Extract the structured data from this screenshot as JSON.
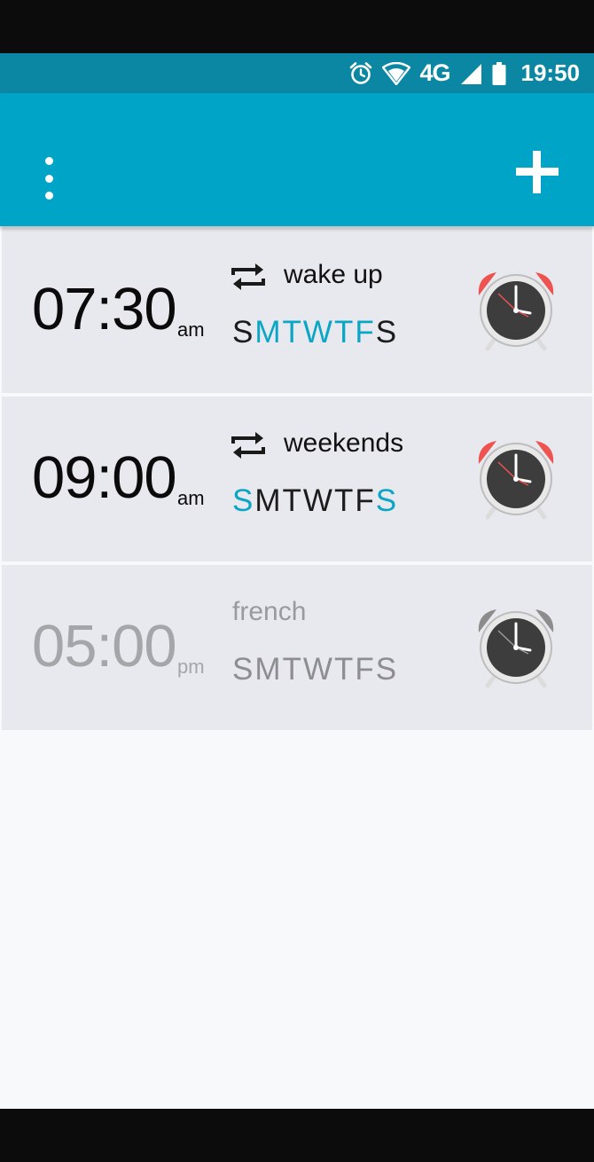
{
  "status_bar": {
    "network": "4G",
    "time": "19:50"
  },
  "app_bar": {
    "menu_icon": "overflow-menu-icon",
    "add_icon": "plus-icon"
  },
  "alarms": [
    {
      "time": "07:30",
      "ampm": "am",
      "label": "wake up",
      "repeat": true,
      "enabled": true,
      "days": [
        "S",
        "M",
        "T",
        "W",
        "T",
        "F",
        "S"
      ],
      "days_active": [
        false,
        true,
        true,
        true,
        true,
        true,
        false
      ]
    },
    {
      "time": "09:00",
      "ampm": "am",
      "label": "weekends",
      "repeat": true,
      "enabled": true,
      "days": [
        "S",
        "M",
        "T",
        "W",
        "T",
        "F",
        "S"
      ],
      "days_active": [
        true,
        false,
        false,
        false,
        false,
        false,
        true
      ]
    },
    {
      "time": "05:00",
      "ampm": "pm",
      "label": "french",
      "repeat": false,
      "enabled": false,
      "days": [
        "S",
        "M",
        "T",
        "W",
        "T",
        "F",
        "S"
      ],
      "days_active": [
        false,
        false,
        false,
        false,
        false,
        false,
        false
      ]
    }
  ],
  "colors": {
    "app_bar": "#00a4c6",
    "status_bar": "#0b87a3",
    "accent_day": "#0ba6c6",
    "alarm_bell_on": "#ef5350",
    "alarm_bell_off": "#8c8c8c"
  }
}
